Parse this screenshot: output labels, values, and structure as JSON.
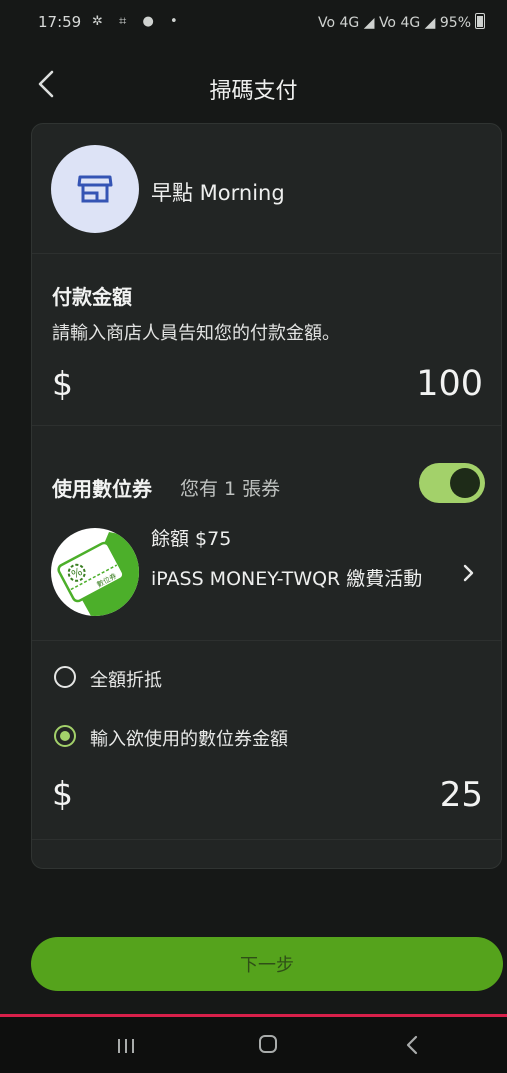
{
  "status_bar": {
    "time": "17:59",
    "icons_left": "✲ ⌗ ● •",
    "icons_right": "Vo 4G ◢ Vo 4G ◢ 95%",
    "battery_label": "95%"
  },
  "header": {
    "title": "掃碼支付",
    "back_icon": "chevron-left-icon"
  },
  "merchant": {
    "name": "早點 Morning",
    "icon": "store-icon",
    "avatar_color": "#dde3f6",
    "icon_color": "#3454b4"
  },
  "payment": {
    "title": "付款金額",
    "hint": "請輸入商店人員告知您的付款金額。",
    "currency": "$",
    "amount": "100"
  },
  "coupon": {
    "label": "使用數位券",
    "count_text": "您有 1 張券",
    "enabled": true,
    "toggle_color": "#a3d16a",
    "balance": "餘額 $75",
    "name": "iPASS MONEY-TWQR 繳費活動",
    "thumb_text": "數位券",
    "thumb_icon": "percent-coupon-icon"
  },
  "options": {
    "full_label": "全額折抵",
    "partial_label": "輸入欲使用的數位券金額",
    "selected": "partial",
    "currency": "$",
    "coupon_amount": "25"
  },
  "actions": {
    "next_label": "下一步",
    "next_color": "#55a31c"
  },
  "nav": {
    "recents_icon": "recents-icon",
    "home_icon": "home-icon",
    "back_icon": "back-icon"
  }
}
